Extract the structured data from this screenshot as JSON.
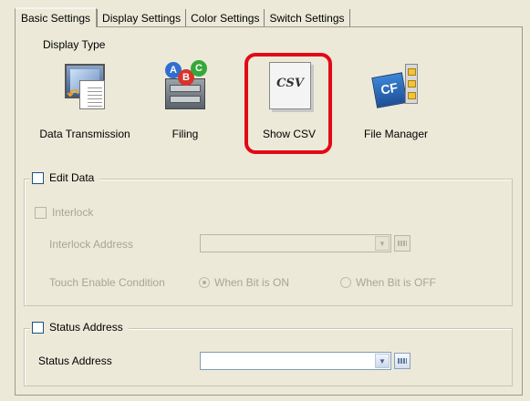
{
  "tabs": [
    {
      "label": "Basic Settings",
      "active": true
    },
    {
      "label": "Display Settings",
      "active": false
    },
    {
      "label": "Color Settings",
      "active": false
    },
    {
      "label": "Switch Settings",
      "active": false
    }
  ],
  "display_type": {
    "label": "Display Type",
    "options": [
      {
        "label": "Data Transmission",
        "icon": "data-transmission-icon"
      },
      {
        "label": "Filing",
        "icon": "filing-icon"
      },
      {
        "label": "Show CSV",
        "icon": "show-csv-icon",
        "icon_text": "CSV",
        "selected": true
      },
      {
        "label": "File Manager",
        "icon": "file-manager-icon",
        "icon_text": "CF"
      }
    ],
    "filing_letters": [
      "A",
      "B",
      "C"
    ]
  },
  "edit_data": {
    "label": "Edit Data",
    "checked": false,
    "interlock": {
      "label": "Interlock",
      "checked": false
    },
    "interlock_address": {
      "label": "Interlock Address",
      "value": ""
    },
    "touch_enable": {
      "label": "Touch Enable Condition",
      "options": [
        "When Bit is ON",
        "When Bit is OFF"
      ],
      "selected": "When Bit is ON"
    }
  },
  "status_address_group": {
    "label": "Status Address",
    "checked": false,
    "field": {
      "label": "Status Address",
      "value": ""
    }
  },
  "colors": {
    "highlight": "#e10a17",
    "window_bg": "#ece9d8"
  }
}
